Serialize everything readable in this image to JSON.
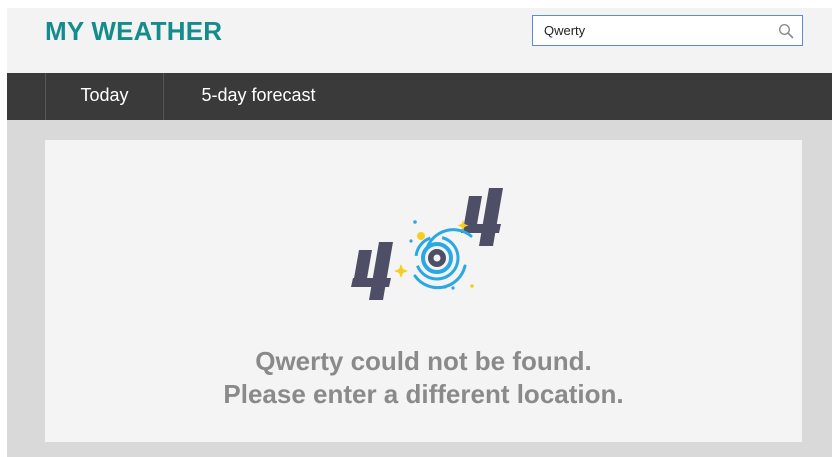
{
  "header": {
    "brand": "MY WEATHER",
    "search": {
      "value": "Qwerty",
      "icon": "search-icon"
    }
  },
  "nav": {
    "tabs": [
      {
        "label": "Today"
      },
      {
        "label": "5-day forecast"
      }
    ]
  },
  "error": {
    "line1": "Qwerty could not be found.",
    "line2": "Please enter a different location."
  },
  "colors": {
    "brand": "#158c8c",
    "nav_bg": "#3a3a3a",
    "message": "#8a8a8a",
    "accent_blue": "#2aa8e6",
    "accent_yellow": "#f5cf1f",
    "digit": "#4e4e66"
  }
}
